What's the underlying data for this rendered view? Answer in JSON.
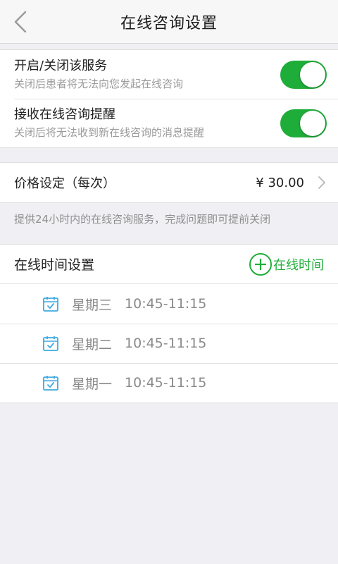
{
  "navbar": {
    "title": "在线咨询设置",
    "back_icon": "chevron-left-icon"
  },
  "settings": [
    {
      "title": "开启/关闭该服务",
      "desc": "关闭后患者将无法向您发起在线咨询",
      "enabled": true
    },
    {
      "title": "接收在线咨询提醒",
      "desc": "关闭后将无法收到新在线咨询的消息提醒",
      "enabled": true
    }
  ],
  "price": {
    "label": "价格设定（每次）",
    "value": "¥ 30.00",
    "chevron_icon": "chevron-right-icon"
  },
  "note": "提供24小时内的在线咨询服务，完成问题即可提前关闭",
  "online_time": {
    "title": "在线时间设置",
    "add_label": "在线时间",
    "add_icon": "plus-circle-icon",
    "slots": [
      {
        "day": "星期三",
        "time": "10:45-11:15"
      },
      {
        "day": "星期二",
        "time": "10:45-11:15"
      },
      {
        "day": "星期一",
        "time": "10:45-11:15"
      }
    ]
  },
  "colors": {
    "accent_green": "#1fad3a",
    "calendar_blue": "#3fa9e0"
  }
}
